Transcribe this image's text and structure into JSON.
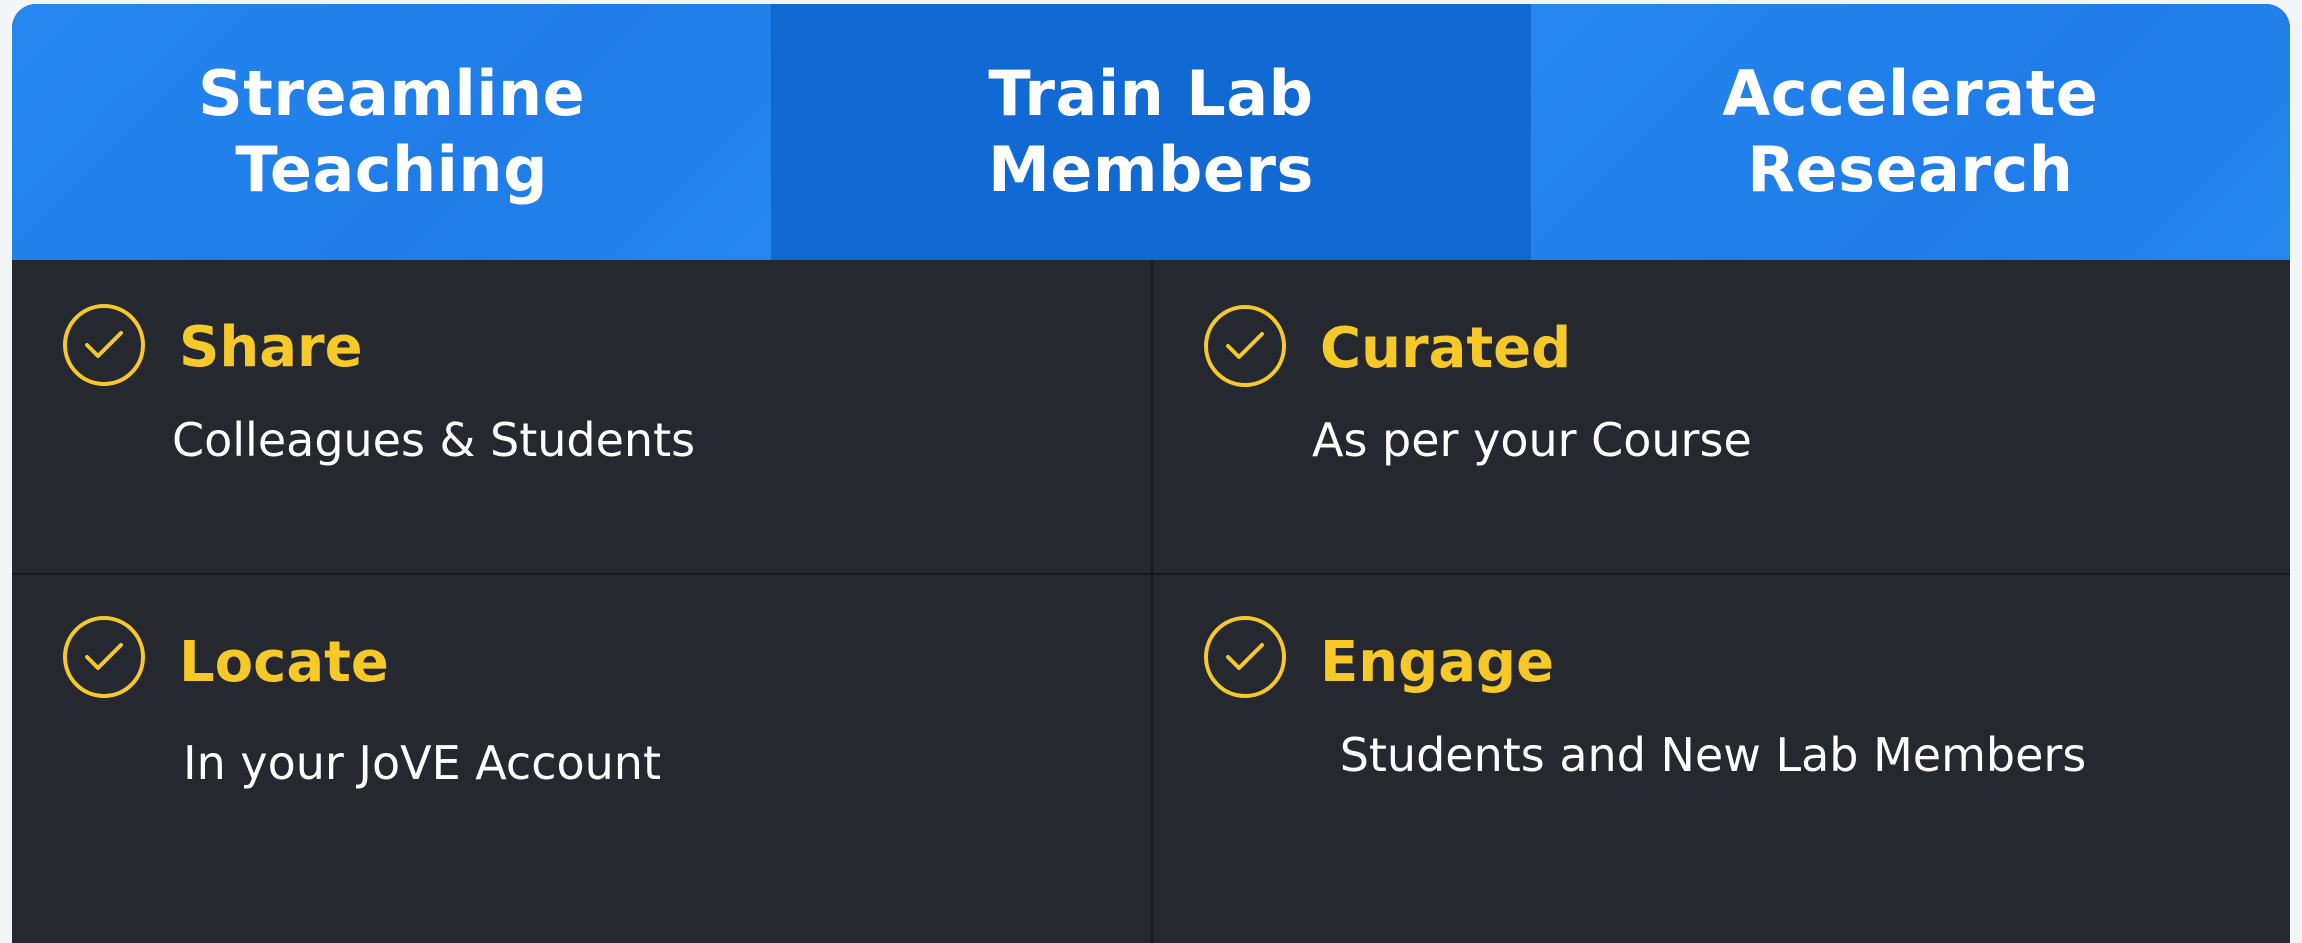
{
  "tabs": [
    {
      "label": "Streamline Teaching",
      "active": false
    },
    {
      "label": "Train Lab Members",
      "active": true
    },
    {
      "label": "Accelerate Research",
      "active": false
    }
  ],
  "features": [
    {
      "title": "Share",
      "subtitle": "Colleagues & Students",
      "icon": "check-circle-icon"
    },
    {
      "title": "Curated",
      "subtitle": "As per your Course",
      "icon": "check-circle-icon"
    },
    {
      "title": "Locate",
      "subtitle": "In your JoVE Account",
      "icon": "check-circle-icon"
    },
    {
      "title": "Engage",
      "subtitle": "Students and New Lab Members",
      "icon": "check-circle-icon"
    }
  ],
  "colors": {
    "tab_blue": "#2487ef",
    "tab_active_blue": "#116ad3",
    "panel_dark": "#25292f",
    "accent_yellow": "#f7c928",
    "text_white": "#ffffff"
  }
}
